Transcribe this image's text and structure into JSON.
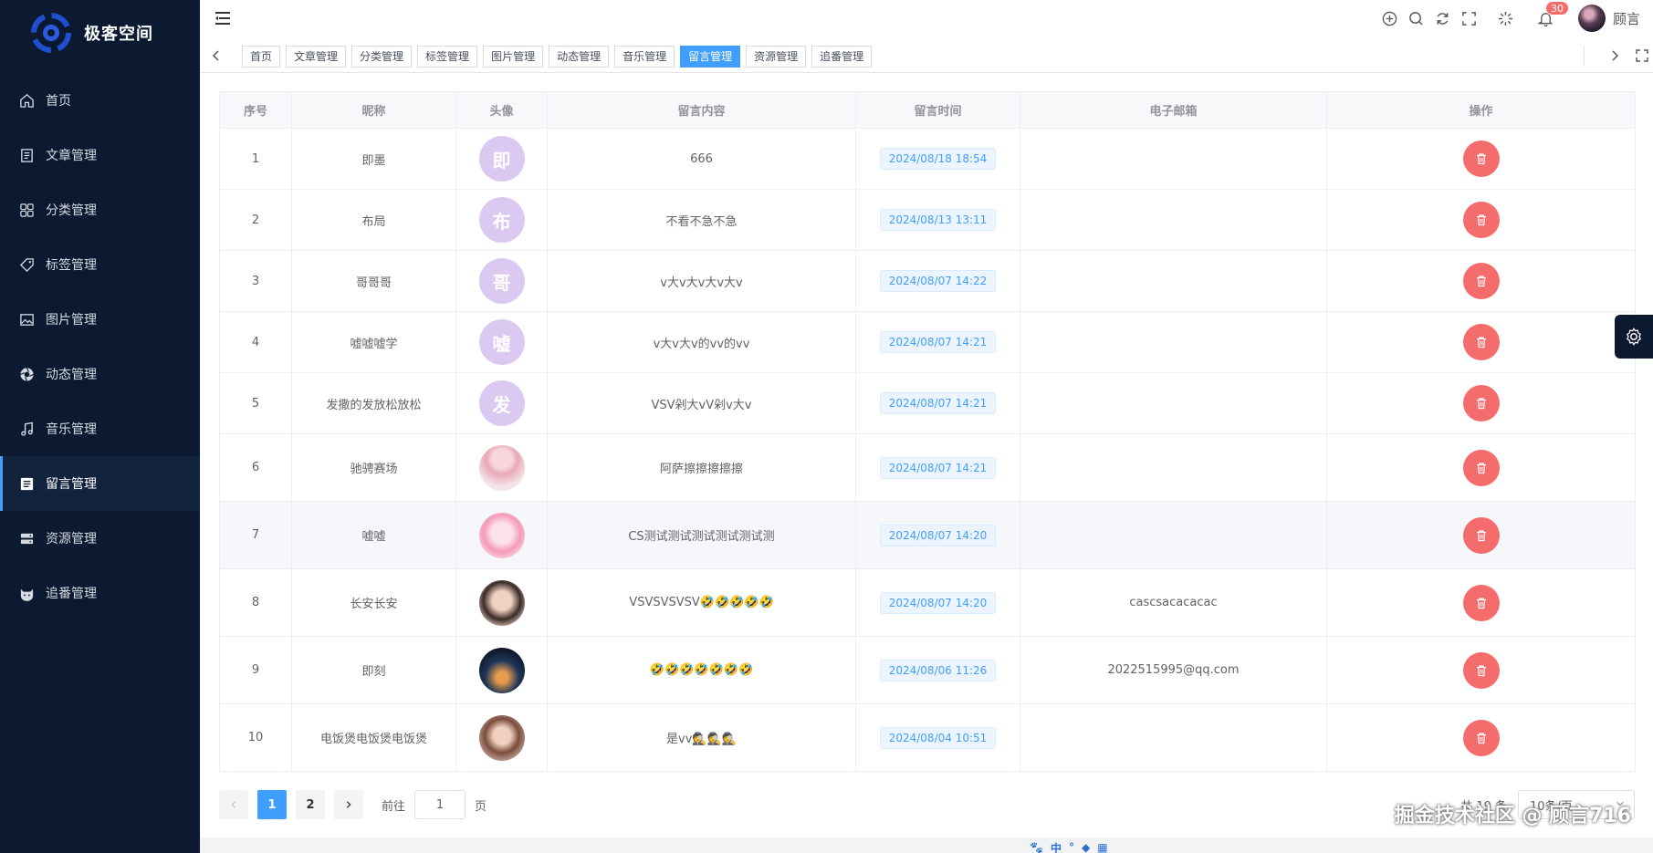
{
  "brand": {
    "title": "极客空间"
  },
  "sidebar": {
    "items": [
      {
        "label": "首页",
        "icon": "home-icon",
        "active": false
      },
      {
        "label": "文章管理",
        "icon": "document-icon",
        "active": false
      },
      {
        "label": "分类管理",
        "icon": "grid-icon",
        "active": false
      },
      {
        "label": "标签管理",
        "icon": "tag-icon",
        "active": false
      },
      {
        "label": "图片管理",
        "icon": "image-icon",
        "active": false
      },
      {
        "label": "动态管理",
        "icon": "aperture-icon",
        "active": false
      },
      {
        "label": "音乐管理",
        "icon": "music-icon",
        "active": false
      },
      {
        "label": "留言管理",
        "icon": "message-list-icon",
        "active": true
      },
      {
        "label": "资源管理",
        "icon": "server-icon",
        "active": false
      },
      {
        "label": "追番管理",
        "icon": "cat-icon",
        "active": false
      }
    ]
  },
  "header": {
    "notification_count": "30",
    "user_name": "顾言"
  },
  "tags": [
    {
      "label": "首页",
      "active": false
    },
    {
      "label": "文章管理",
      "active": false
    },
    {
      "label": "分类管理",
      "active": false
    },
    {
      "label": "标签管理",
      "active": false
    },
    {
      "label": "图片管理",
      "active": false
    },
    {
      "label": "动态管理",
      "active": false
    },
    {
      "label": "音乐管理",
      "active": false
    },
    {
      "label": "留言管理",
      "active": true
    },
    {
      "label": "资源管理",
      "active": false
    },
    {
      "label": "追番管理",
      "active": false
    }
  ],
  "table": {
    "columns": [
      "序号",
      "昵称",
      "头像",
      "留言内容",
      "留言时间",
      "电子邮箱",
      "操作"
    ],
    "rows": [
      {
        "index": "1",
        "nickname": "即墨",
        "avatar_letter": "即",
        "avatar_type": "letter",
        "content": "666",
        "time": "2024/08/18 18:54",
        "email": ""
      },
      {
        "index": "2",
        "nickname": "布局",
        "avatar_letter": "布",
        "avatar_type": "letter",
        "content": "不看不急不急",
        "time": "2024/08/13 13:11",
        "email": ""
      },
      {
        "index": "3",
        "nickname": "哥哥哥",
        "avatar_letter": "哥",
        "avatar_type": "letter",
        "content": "v大v大v大v大v",
        "time": "2024/08/07 14:22",
        "email": ""
      },
      {
        "index": "4",
        "nickname": "嘘嘘嘘学",
        "avatar_letter": "嘘",
        "avatar_type": "letter",
        "content": "v大v大v的vv的vv",
        "time": "2024/08/07 14:21",
        "email": ""
      },
      {
        "index": "5",
        "nickname": "发撒的发放松放松",
        "avatar_letter": "发",
        "avatar_type": "letter",
        "content": "VSV剁大vV剁v大v",
        "time": "2024/08/07 14:21",
        "email": ""
      },
      {
        "index": "6",
        "nickname": "驰骋赛场",
        "avatar_letter": "",
        "avatar_type": "img1",
        "content": "阿萨擦擦擦擦擦",
        "time": "2024/08/07 14:21",
        "email": ""
      },
      {
        "index": "7",
        "nickname": "嘘嘘",
        "avatar_letter": "",
        "avatar_type": "img2",
        "content": "CS测试测试测试测试测试测",
        "time": "2024/08/07 14:20",
        "email": ""
      },
      {
        "index": "8",
        "nickname": "长安长安",
        "avatar_letter": "",
        "avatar_type": "img3",
        "content": "VSVSVSVSV🤣🤣🤣🤣🤣",
        "time": "2024/08/07 14:20",
        "email": "cascsacacacac"
      },
      {
        "index": "9",
        "nickname": "即刻",
        "avatar_letter": "",
        "avatar_type": "img4",
        "content": "🤣🤣🤣🤣🤣🤣🤣",
        "time": "2024/08/06 11:26",
        "email": "2022515995@qq.com"
      },
      {
        "index": "10",
        "nickname": "电饭煲电饭煲电饭煲",
        "avatar_letter": "",
        "avatar_type": "img5",
        "content": "是vv🕵️🕵️🕵️",
        "time": "2024/08/04 10:51",
        "email": ""
      }
    ]
  },
  "pagination": {
    "pages": [
      "1",
      "2"
    ],
    "current": "1",
    "goto_label": "前往",
    "goto_value": "1",
    "page_suffix": "页",
    "total_text": "共 19 条",
    "page_size_text": "10条/页"
  },
  "watermark": "掘金技术社区 @ 顾言716",
  "colors": {
    "sidebar_bg": "#0b1a30",
    "primary": "#409eff",
    "danger": "#f56c6c"
  }
}
